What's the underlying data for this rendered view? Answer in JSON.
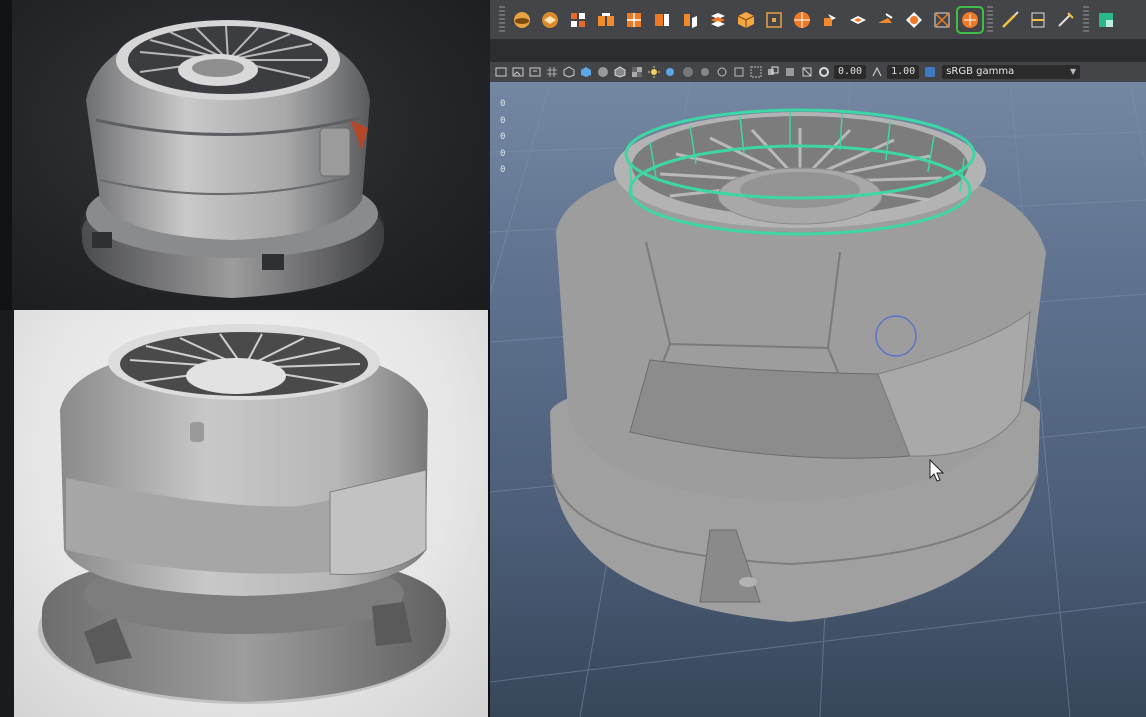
{
  "panel_toolbar": {
    "exposure_value": "0.00",
    "gamma_value": "1.00",
    "color_management": "sRGB gamma"
  },
  "viewport": {
    "hud_values": [
      "0",
      "0",
      "0",
      "0",
      "0"
    ]
  },
  "shelf": {
    "icons": [
      "sphere-icon",
      "bevel-icon",
      "extrude-icon",
      "bridge-icon",
      "combine-icon",
      "separate-icon",
      "extract-icon",
      "booleans-icon",
      "cube-icon",
      "uv-icon",
      "target-weld-icon",
      "split-icon",
      "fill-hole-icon",
      "wedge-icon",
      "append-icon",
      "cut-faces-icon",
      "smooth-icon",
      "multicut-icon",
      "edge-loop-icon",
      "offset-loop-icon",
      "slide-edge-icon"
    ],
    "selected": "smooth-icon"
  },
  "colors": {
    "selection": "#3dd6a4",
    "viewport_bg": "#5f7390",
    "ui_panel": "#444548"
  }
}
